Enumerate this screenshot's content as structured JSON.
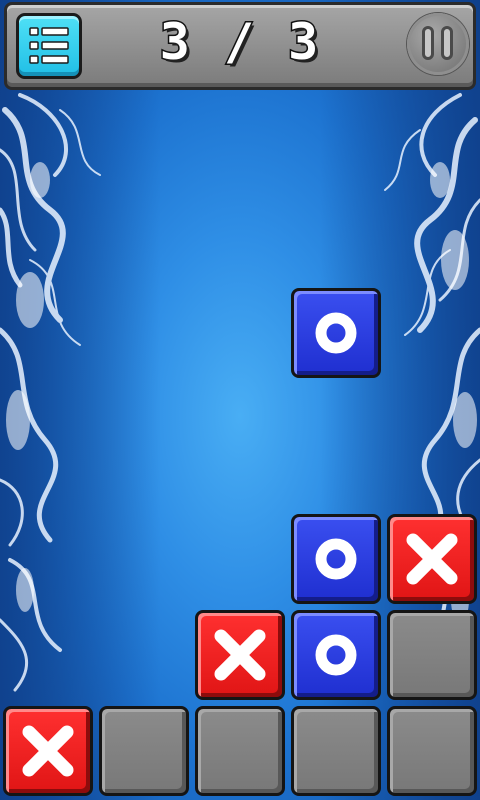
{
  "header": {
    "level_text": "3 / 3",
    "menu_icon": "list-menu-icon",
    "pause_icon": "pause-icon"
  },
  "colors": {
    "background": "#2f8fe6",
    "menu_button": "#21bfe6",
    "o_tile": "#1f2fd0",
    "x_tile": "#e01515",
    "empty_tile": "#808080"
  },
  "board": {
    "falling_piece": {
      "mark": "O",
      "column": 3
    },
    "rows_from_bottom": [
      [
        "X",
        "",
        "",
        "",
        ""
      ],
      [
        "",
        "",
        "X",
        "O",
        ""
      ],
      [
        "",
        "",
        "",
        "O",
        "X"
      ]
    ],
    "columns": 5
  }
}
